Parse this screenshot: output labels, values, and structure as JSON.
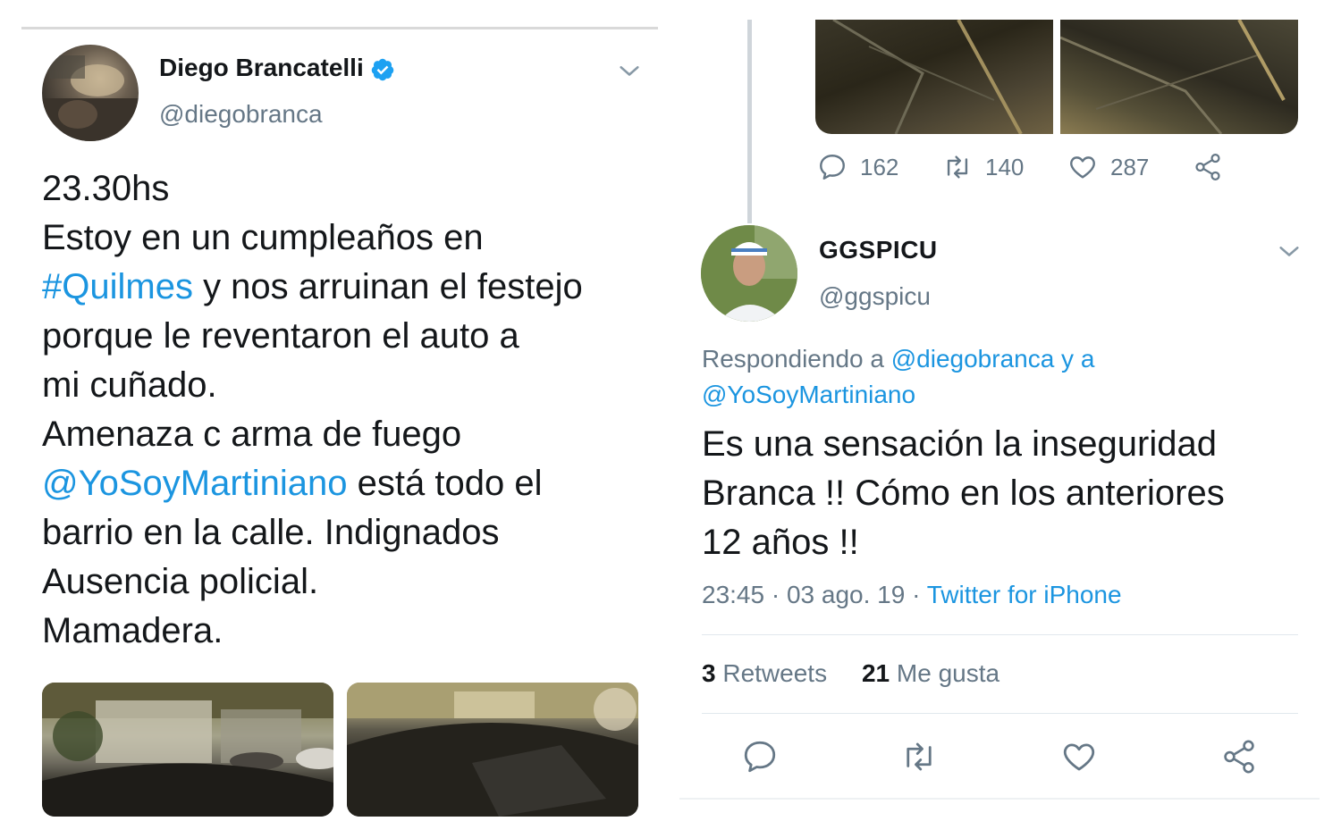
{
  "left_tweet": {
    "author_name": "Diego Brancatelli",
    "handle": "@diegobranca",
    "lines": [
      {
        "text": "23.30hs"
      },
      {
        "text": "Estoy en un cumpleaños en"
      },
      {
        "hashtag": "#Quilmes",
        "text": " y nos arruinan el festejo"
      },
      {
        "text": "porque le reventaron el auto a"
      },
      {
        "text": "mi cuñado."
      },
      {
        "text": "Amenaza c arma de fuego"
      },
      {
        "mention": "@YoSoyMartiniano",
        "text": " está todo el"
      },
      {
        "text": "barrio en la calle. Indignados"
      },
      {
        "text": "Ausencia policial."
      },
      {
        "text": "Mamadera."
      }
    ]
  },
  "thread_actions": {
    "replies": "162",
    "retweets": "140",
    "likes": "287"
  },
  "right_tweet": {
    "author_name": "GGSPICU",
    "handle": "@ggspicu",
    "replying_prefix": "Respondiendo a ",
    "replying_mention1": "@diegobranca",
    "replying_mid": " y a",
    "replying_mention2": "@YoSoyMartiniano",
    "text_lines": [
      "Es una sensación la inseguridad",
      "Branca !! Cómo en los anteriores",
      "12 años !!"
    ],
    "time": "23:45",
    "separator": " · ",
    "date": "03 ago. 19",
    "separator2": " · ",
    "source": "Twitter for iPhone",
    "retweets_count": "3",
    "retweets_label": " Retweets",
    "likes_count": "21",
    "likes_label": " Me gusta"
  },
  "colors": {
    "link_blue": "#1b95e0",
    "text_dark": "#14171a",
    "text_grey": "#657786",
    "divider": "#e1e8ed"
  }
}
